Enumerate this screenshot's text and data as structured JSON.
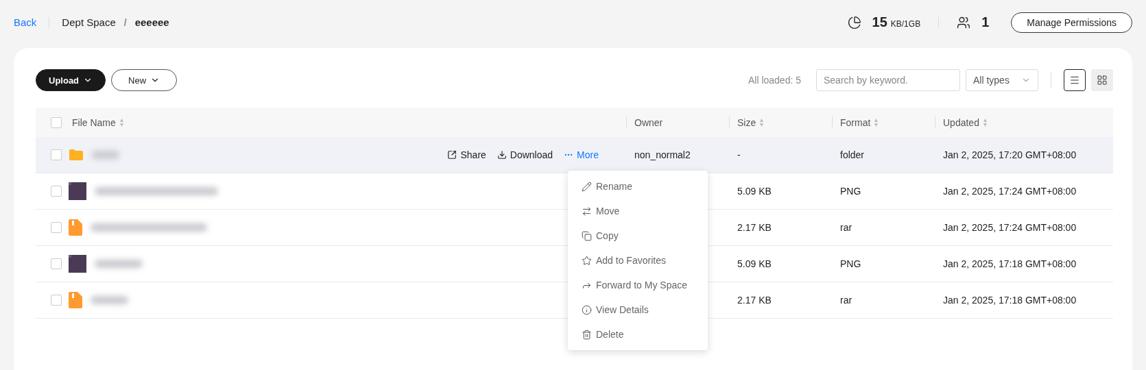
{
  "header": {
    "back": "Back",
    "breadcrumb": [
      {
        "label": "Dept Space",
        "current": false
      },
      {
        "label": "eeeeee",
        "current": true
      }
    ],
    "separator": "/",
    "storage": {
      "used": "15",
      "unit": "KB/1GB"
    },
    "members": "1",
    "manage_button": "Manage Permissions"
  },
  "toolbar": {
    "upload": "Upload",
    "new": "New",
    "loaded": "All loaded: 5",
    "search": {
      "placeholder": "Search by keyword."
    },
    "type_filter": "All types",
    "views": [
      {
        "kind": "list",
        "selected": true
      },
      {
        "kind": "grid",
        "selected": false
      }
    ]
  },
  "table": {
    "select_all_checked": false,
    "columns": [
      {
        "label": "File Name",
        "sortable": true
      },
      {
        "label": "Owner",
        "sortable": false
      },
      {
        "label": "Size",
        "sortable": true
      },
      {
        "label": "Format",
        "sortable": true
      },
      {
        "label": "Updated",
        "sortable": true
      }
    ],
    "rows": [
      {
        "kind": "folder",
        "hovered": true,
        "checked": false,
        "owner": "non_normal2",
        "size": "-",
        "format": "folder",
        "updated": "Jan 2, 2025, 17:20 GMT+08:00",
        "actions": [
          "Share",
          "Download",
          "More"
        ]
      },
      {
        "kind": "image",
        "hovered": false,
        "checked": false,
        "size": "5.09 KB",
        "format": "PNG",
        "updated": "Jan 2, 2025, 17:24 GMT+08:00"
      },
      {
        "kind": "archive",
        "hovered": false,
        "checked": false,
        "size": "2.17 KB",
        "format": "rar",
        "updated": "Jan 2, 2025, 17:24 GMT+08:00"
      },
      {
        "kind": "image",
        "hovered": false,
        "checked": false,
        "size": "5.09 KB",
        "format": "PNG",
        "updated": "Jan 2, 2025, 17:18 GMT+08:00"
      },
      {
        "kind": "archive",
        "hovered": false,
        "checked": false,
        "size": "2.17 KB",
        "format": "rar",
        "updated": "Jan 2, 2025, 17:18 GMT+08:00"
      }
    ]
  },
  "more_menu": [
    {
      "kind": "rename",
      "label": "Rename"
    },
    {
      "kind": "move",
      "label": "Move"
    },
    {
      "kind": "copy",
      "label": "Copy"
    },
    {
      "kind": "favorite",
      "label": "Add to Favorites"
    },
    {
      "kind": "forward",
      "label": "Forward to My Space"
    },
    {
      "kind": "details",
      "label": "View Details"
    },
    {
      "kind": "delete",
      "label": "Delete"
    }
  ]
}
